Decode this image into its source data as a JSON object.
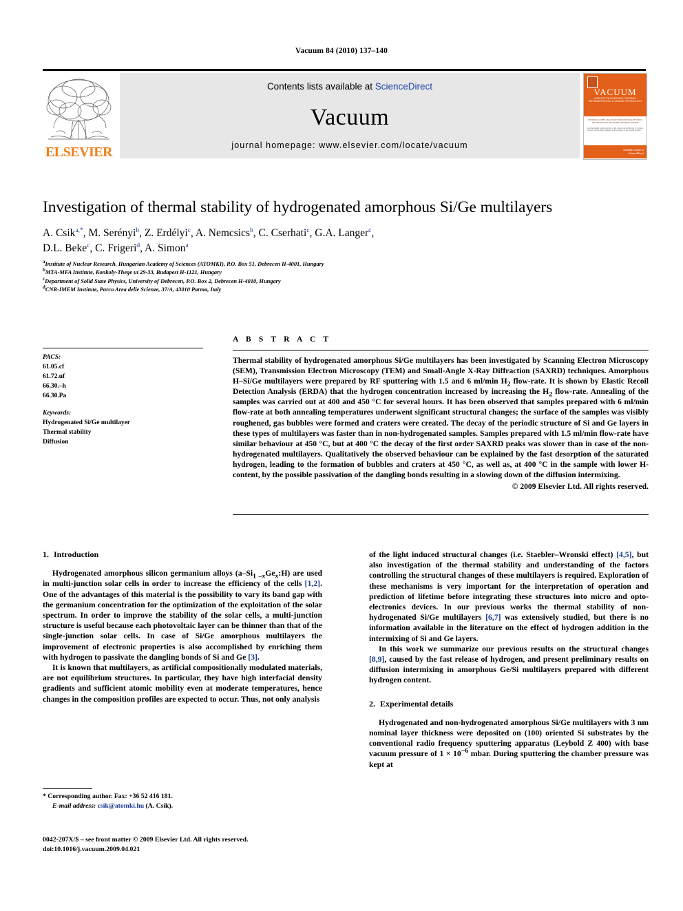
{
  "running_head": "Vacuum 84 (2010) 137–140",
  "masthead": {
    "publisher": "ELSEVIER",
    "contents_prefix": "Contents lists available at ",
    "contents_link": "ScienceDirect",
    "journal_name": "Vacuum",
    "homepage": "journal homepage: www.elsevier.com/locate/vacuum",
    "cover": {
      "title": "VACUUM",
      "subtitle": "SURFACE ENGINEERING, SURFACE INSTRUMENTATION & VACUUM TECHNOLOGY",
      "authors_line": "EDITOR-IN-CHIEF    ASSOCIATE EDITORS    BOOK REVIEWS\nINTERNATIONAL ADVISORY   EDITORIAL BOARD",
      "abstract_snippet": "An international journal devoted to the science and technology of vacuum, surfaces and thin films, published with the support of the vacuum societies.",
      "sciencedirect": "Available online at\nScienceDirect"
    }
  },
  "article": {
    "title": "Investigation of thermal stability of hydrogenated amorphous Si/Ge multilayers",
    "authors_line1": "A. Csik a,*, M. Serényi b, Z. Erdélyi c, A. Nemcsics b, C. Cserhati c, G.A. Langer c,",
    "authors_line2": "D.L. Beke c, C. Frigeri d, A. Simon a",
    "affiliations": [
      {
        "mark": "a",
        "text": "Institute of Nuclear Research, Hungarian Academy of Sciences (ATOMKI), P.O. Box 51, Debrecen H-4001, Hungary"
      },
      {
        "mark": "b",
        "text": "MTA-MFA Institute, Konkoly-Thege ut 29-33, Budapest H-1121, Hungary"
      },
      {
        "mark": "c",
        "text": "Department of Solid State Physics, University of Debrecen, P.O. Box 2, Debrecen H-4010, Hungary"
      },
      {
        "mark": "d",
        "text": "CNR-IMEM Institute, Parco Area delle Scienze, 37/A, 43010 Parma, Italy"
      }
    ]
  },
  "meta": {
    "pacs_label": "PACS:",
    "pacs": [
      "61.05.cf",
      "61.72.uf",
      "66.30.–h",
      "66.30.Pa"
    ],
    "keywords_label": "Keywords:",
    "keywords": [
      "Hydrogenated Si/Ge multilayer",
      "Thermal stability",
      "Diffusion"
    ]
  },
  "abstract": {
    "heading": "A B S T R A C T",
    "text": "Thermal stability of hydrogenated amorphous Si/Ge multilayers has been investigated by Scanning Electron Microscopy (SEM), Transmission Electron Microscopy (TEM) and Small-Angle X-Ray Diffraction (SAXRD) techniques. Amorphous H–Si/Ge multilayers were prepared by RF sputtering with 1.5 and 6 ml/min H2 flow-rate. It is shown by Elastic Recoil Detection Analysis (ERDA) that the hydrogen concentration increased by increasing the H2 flow-rate. Annealing of the samples was carried out at 400 and 450 °C for several hours. It has been observed that samples prepared with 6 ml/min flow-rate at both annealing temperatures underwent significant structural changes; the surface of the samples was visibly roughened, gas bubbles were formed and craters were created. The decay of the periodic structure of Si and Ge layers in these types of multilayers was faster than in non-hydrogenated samples. Samples prepared with 1.5 ml/min flow-rate have similar behaviour at 450 °C, but at 400 °C the decay of the first order SAXRD peaks was slower than in case of the non-hydrogenated multilayers. Qualitatively the observed behaviour can be explained by the fast desorption of the saturated hydrogen, leading to the formation of bubbles and craters at 450 °C, as well as, at 400 °C in the sample with lower H-content, by the possible passivation of the dangling bonds resulting in a slowing down of the diffusion intermixing.",
    "copyright": "© 2009 Elsevier Ltd. All rights reserved."
  },
  "sections": {
    "introduction": {
      "number": "1.",
      "title": "Introduction",
      "p1": "Hydrogenated amorphous silicon germanium alloys (a–Si1 –xGex:H) are used in multi-junction solar cells in order to increase the efficiency of the cells [1,2]. One of the advantages of this material is the possibility to vary its band gap with the germanium concentration for the optimization of the exploitation of the solar spectrum. In order to improve the stability of the solar cells, a multi-junction structure is useful because each photovoltaic layer can be thinner than that of the single-junction solar cells. In case of Si/Ge amorphous multilayers the improvement of electronic properties is also accomplished by enriching them with hydrogen to passivate the dangling bonds of Si and Ge [3].",
      "p2": "It is known that multilayers, as artificial compositionally modulated materials, are not equilibrium structures. In particular, they have high interfacial density gradients and sufficient atomic mobility even at moderate temperatures, hence changes in the composition profiles are expected to occur. Thus, not only analysis",
      "p3": "of the light induced structural changes (i.e. Staebler–Wronski effect) [4,5], but also investigation of the thermal stability and understanding of the factors controlling the structural changes of these multilayers is required. Exploration of these mechanisms is very important for the interpretation of operation and prediction of lifetime before integrating these structures into micro and opto-electronics devices. In our previous works the thermal stability of non-hydrogenated Si/Ge multilayers [6,7] was extensively studied, but there is no information available in the literature on the effect of hydrogen addition in the intermixing of Si and Ge layers.",
      "p4": "In this work we summarize our previous results on the structural changes [8,9], caused by the fast release of hydrogen, and present preliminary results on diffusion intermixing in amorphous Ge/Si multilayers prepared with different hydrogen content."
    },
    "experimental": {
      "number": "2.",
      "title": "Experimental details",
      "p1": "Hydrogenated and non-hydrogenated amorphous Si/Ge multilayers with 3 nm nominal layer thickness were deposited on (100) oriented Si substrates by the conventional radio frequency sputtering apparatus (Leybold Z 400) with base vacuum pressure of 1 × 10−6 mbar. During sputtering the chamber pressure was kept at"
    }
  },
  "footnote": {
    "corresponding": "* Corresponding author. Fax: +36 52 416 181.",
    "email_label": "E-mail address:",
    "email": "csik@atomki.hu",
    "email_person": "(A. Csik)."
  },
  "footer": {
    "line1": "0042-207X/$ – see front matter © 2009 Elsevier Ltd. All rights reserved.",
    "line2": "doi:10.1016/j.vacuum.2009.04.021"
  },
  "colors": {
    "elsevier_orange": "#F07F1A",
    "link_blue": "#2346a8",
    "reference_blue": "#1a3a8f",
    "masthead_grey": "#e7e7e7",
    "cover_orange": "#E2601A"
  }
}
